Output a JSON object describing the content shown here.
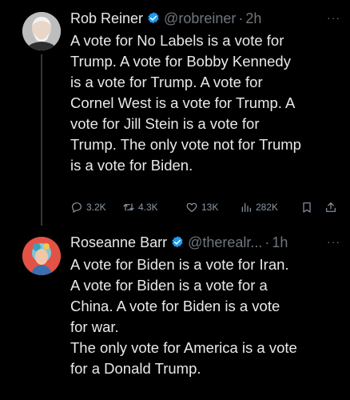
{
  "tweets": [
    {
      "name": "Rob Reiner",
      "handle": "@robreiner",
      "separator": "·",
      "time": "2h",
      "text": "A vote for No Labels is a vote for\nTrump. A vote for Bobby Kennedy\nis a vote for Trump. A vote for\nCornel West is a vote for Trump. A\nvote for Jill Stein is a vote for\nTrump. The only vote not for Trump\nis a vote for Biden.",
      "more": "···",
      "stats": {
        "replies": "3.2K",
        "retweets": "4.3K",
        "likes": "13K",
        "views": "282K"
      }
    },
    {
      "name": "Roseanne Barr",
      "handle": "@therealr...",
      "separator": "·",
      "time": "1h",
      "text": "A vote for Biden is a vote for Iran.\nA vote for Biden is a vote for a\nChina. A vote for Biden is a vote\nfor war.\nThe only vote for America is a vote\nfor a Donald Trump.",
      "more": "···"
    }
  ],
  "icons": {
    "verified": "verified-badge-icon",
    "reply": "reply-icon",
    "retweet": "retweet-icon",
    "like": "heart-icon",
    "views": "views-icon",
    "bookmark": "bookmark-icon",
    "share": "share-icon"
  },
  "colors": {
    "background": "#000000",
    "text": "#e7e9ea",
    "muted": "#71767b",
    "verified": "#1d9bf0"
  }
}
